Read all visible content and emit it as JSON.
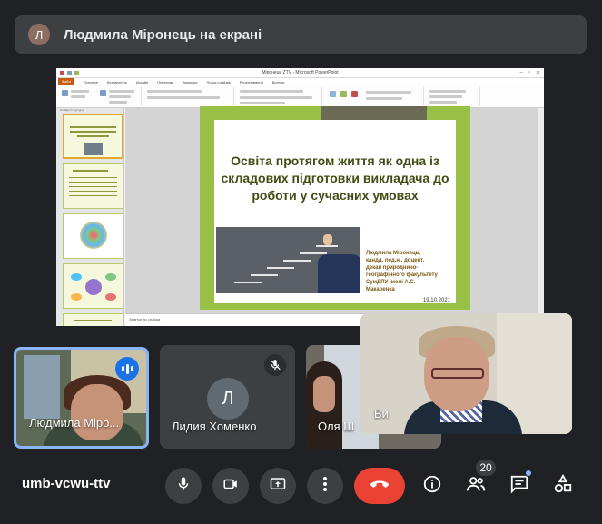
{
  "banner": {
    "avatar_initial": "Л",
    "text": "Людмила Міронець на екрані"
  },
  "presentation": {
    "window_title": "Міронець ZTV - Microsoft PowerPoint",
    "menu_file": "Файл",
    "menu_items": [
      "Основне",
      "Вставлення",
      "Дизайн",
      "Переходи",
      "Анімація",
      "Показ слайдів",
      "Рецензування",
      "Вигляд"
    ],
    "thumb_tabs": "Слайди   Структура",
    "slide_numbers": [
      "1",
      "2",
      "3",
      "4",
      "5"
    ],
    "notes_placeholder": "Замітки до слайда",
    "slide": {
      "title": "Освіта протягом життя як одна із складових підготовки викладача до роботи у сучасних умовах",
      "author": "Людмила Міронець, кандд. пед.н., доцент, декан природничо-географічного факультету СумДПУ імені А.С. Макаренка",
      "date": "19.10.2021"
    }
  },
  "participants": [
    {
      "name": "Людмила Міро...",
      "state": "speaking"
    },
    {
      "name": "Лидия Хоменко",
      "initial": "Л",
      "state": "muted"
    },
    {
      "name": "Оля Ш",
      "state": "video"
    },
    {
      "name": "Ви",
      "state": "self-view"
    }
  ],
  "meeting": {
    "code": "umb-vcwu-ttv",
    "people_count": "20"
  },
  "colors": {
    "end_call": "#ea4335",
    "speaking": "#1a73e8",
    "active_border": "#8ab4f8",
    "slide_green": "#98bf46"
  },
  "controls": [
    "mic-icon",
    "camera-icon",
    "present-screen-icon",
    "more-options-icon",
    "end-call-icon",
    "info-icon",
    "people-icon",
    "chat-icon",
    "activities-icon"
  ]
}
